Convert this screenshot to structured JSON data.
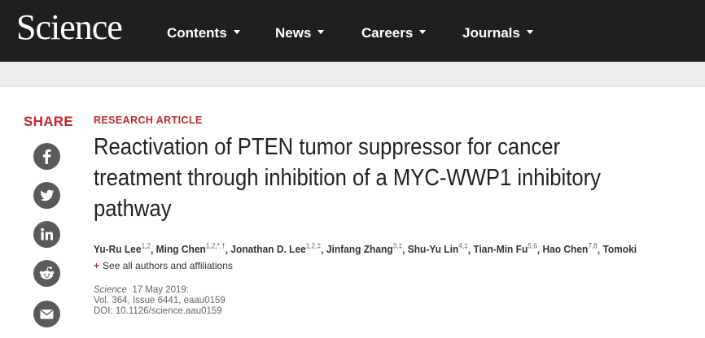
{
  "nav": {
    "brand": "Science",
    "items": [
      {
        "label": "Contents"
      },
      {
        "label": "News"
      },
      {
        "label": "Careers"
      },
      {
        "label": "Journals"
      }
    ]
  },
  "share": {
    "label": "SHARE",
    "buttons": [
      {
        "icon": "facebook-icon"
      },
      {
        "icon": "twitter-icon"
      },
      {
        "icon": "linkedin-icon"
      },
      {
        "icon": "reddit-icon"
      },
      {
        "icon": "email-icon"
      }
    ]
  },
  "article": {
    "type": "RESEARCH ARTICLE",
    "title": "Reactivation of PTEN tumor suppressor for cancer treatment through inhibition of a MYC-WWP1 inhibitory pathway",
    "authors": [
      {
        "name": "Yu-Ru Lee",
        "aff": "1,2",
        "sep": ", "
      },
      {
        "name": "Ming Chen",
        "aff": "1,2,*,†",
        "sep": ", "
      },
      {
        "name": "Jonathan D. Lee",
        "aff": "1,2,‡",
        "sep": ", "
      },
      {
        "name": "Jinfang Zhang",
        "aff": "3,‡",
        "sep": ", "
      },
      {
        "name": "Shu-Yu Lin",
        "aff": "4,‡",
        "sep": ", "
      },
      {
        "name": "Tian-Min Fu",
        "aff": "5,6",
        "sep": ", "
      },
      {
        "name": "Hao Chen",
        "aff": "7,8",
        "sep": ", "
      },
      {
        "name": "Tomoki Is...",
        "aff": "",
        "sep": ""
      }
    ],
    "see_all": "See all authors and affiliations",
    "journal": "Science",
    "date": "17 May 2019:",
    "volume": "Vol. 364, Issue 6441, eaau0159",
    "doi": "DOI: 10.1126/science.aau0159"
  },
  "colors": {
    "nav_bg": "#1f1f1f",
    "accent": "#c1272d",
    "share_icon_bg": "#5a5a5a"
  }
}
